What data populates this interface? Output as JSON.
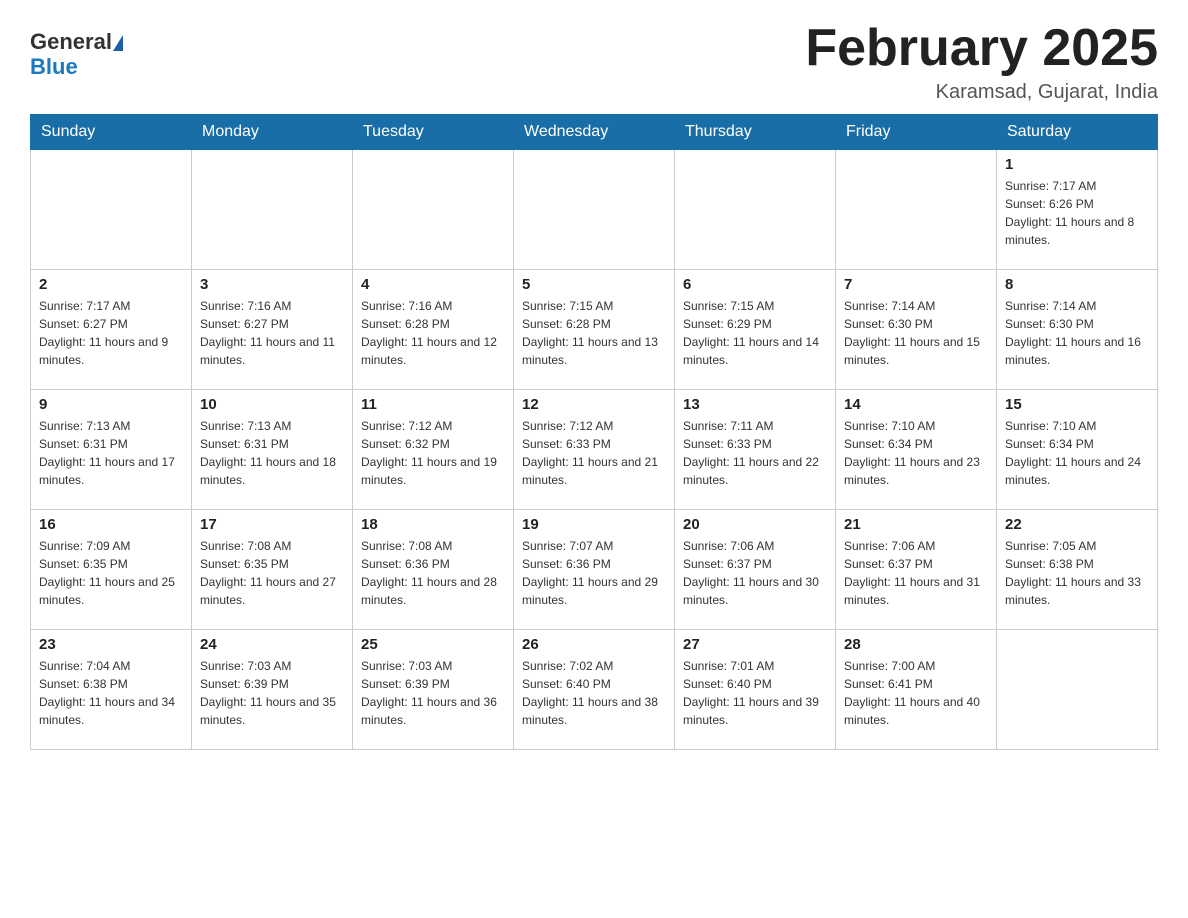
{
  "header": {
    "logo_general": "General",
    "logo_blue": "Blue",
    "month_title": "February 2025",
    "location": "Karamsad, Gujarat, India"
  },
  "days_of_week": [
    "Sunday",
    "Monday",
    "Tuesday",
    "Wednesday",
    "Thursday",
    "Friday",
    "Saturday"
  ],
  "weeks": [
    [
      {
        "day": "",
        "sunrise": "",
        "sunset": "",
        "daylight": ""
      },
      {
        "day": "",
        "sunrise": "",
        "sunset": "",
        "daylight": ""
      },
      {
        "day": "",
        "sunrise": "",
        "sunset": "",
        "daylight": ""
      },
      {
        "day": "",
        "sunrise": "",
        "sunset": "",
        "daylight": ""
      },
      {
        "day": "",
        "sunrise": "",
        "sunset": "",
        "daylight": ""
      },
      {
        "day": "",
        "sunrise": "",
        "sunset": "",
        "daylight": ""
      },
      {
        "day": "1",
        "sunrise": "Sunrise: 7:17 AM",
        "sunset": "Sunset: 6:26 PM",
        "daylight": "Daylight: 11 hours and 8 minutes."
      }
    ],
    [
      {
        "day": "2",
        "sunrise": "Sunrise: 7:17 AM",
        "sunset": "Sunset: 6:27 PM",
        "daylight": "Daylight: 11 hours and 9 minutes."
      },
      {
        "day": "3",
        "sunrise": "Sunrise: 7:16 AM",
        "sunset": "Sunset: 6:27 PM",
        "daylight": "Daylight: 11 hours and 11 minutes."
      },
      {
        "day": "4",
        "sunrise": "Sunrise: 7:16 AM",
        "sunset": "Sunset: 6:28 PM",
        "daylight": "Daylight: 11 hours and 12 minutes."
      },
      {
        "day": "5",
        "sunrise": "Sunrise: 7:15 AM",
        "sunset": "Sunset: 6:28 PM",
        "daylight": "Daylight: 11 hours and 13 minutes."
      },
      {
        "day": "6",
        "sunrise": "Sunrise: 7:15 AM",
        "sunset": "Sunset: 6:29 PM",
        "daylight": "Daylight: 11 hours and 14 minutes."
      },
      {
        "day": "7",
        "sunrise": "Sunrise: 7:14 AM",
        "sunset": "Sunset: 6:30 PM",
        "daylight": "Daylight: 11 hours and 15 minutes."
      },
      {
        "day": "8",
        "sunrise": "Sunrise: 7:14 AM",
        "sunset": "Sunset: 6:30 PM",
        "daylight": "Daylight: 11 hours and 16 minutes."
      }
    ],
    [
      {
        "day": "9",
        "sunrise": "Sunrise: 7:13 AM",
        "sunset": "Sunset: 6:31 PM",
        "daylight": "Daylight: 11 hours and 17 minutes."
      },
      {
        "day": "10",
        "sunrise": "Sunrise: 7:13 AM",
        "sunset": "Sunset: 6:31 PM",
        "daylight": "Daylight: 11 hours and 18 minutes."
      },
      {
        "day": "11",
        "sunrise": "Sunrise: 7:12 AM",
        "sunset": "Sunset: 6:32 PM",
        "daylight": "Daylight: 11 hours and 19 minutes."
      },
      {
        "day": "12",
        "sunrise": "Sunrise: 7:12 AM",
        "sunset": "Sunset: 6:33 PM",
        "daylight": "Daylight: 11 hours and 21 minutes."
      },
      {
        "day": "13",
        "sunrise": "Sunrise: 7:11 AM",
        "sunset": "Sunset: 6:33 PM",
        "daylight": "Daylight: 11 hours and 22 minutes."
      },
      {
        "day": "14",
        "sunrise": "Sunrise: 7:10 AM",
        "sunset": "Sunset: 6:34 PM",
        "daylight": "Daylight: 11 hours and 23 minutes."
      },
      {
        "day": "15",
        "sunrise": "Sunrise: 7:10 AM",
        "sunset": "Sunset: 6:34 PM",
        "daylight": "Daylight: 11 hours and 24 minutes."
      }
    ],
    [
      {
        "day": "16",
        "sunrise": "Sunrise: 7:09 AM",
        "sunset": "Sunset: 6:35 PM",
        "daylight": "Daylight: 11 hours and 25 minutes."
      },
      {
        "day": "17",
        "sunrise": "Sunrise: 7:08 AM",
        "sunset": "Sunset: 6:35 PM",
        "daylight": "Daylight: 11 hours and 27 minutes."
      },
      {
        "day": "18",
        "sunrise": "Sunrise: 7:08 AM",
        "sunset": "Sunset: 6:36 PM",
        "daylight": "Daylight: 11 hours and 28 minutes."
      },
      {
        "day": "19",
        "sunrise": "Sunrise: 7:07 AM",
        "sunset": "Sunset: 6:36 PM",
        "daylight": "Daylight: 11 hours and 29 minutes."
      },
      {
        "day": "20",
        "sunrise": "Sunrise: 7:06 AM",
        "sunset": "Sunset: 6:37 PM",
        "daylight": "Daylight: 11 hours and 30 minutes."
      },
      {
        "day": "21",
        "sunrise": "Sunrise: 7:06 AM",
        "sunset": "Sunset: 6:37 PM",
        "daylight": "Daylight: 11 hours and 31 minutes."
      },
      {
        "day": "22",
        "sunrise": "Sunrise: 7:05 AM",
        "sunset": "Sunset: 6:38 PM",
        "daylight": "Daylight: 11 hours and 33 minutes."
      }
    ],
    [
      {
        "day": "23",
        "sunrise": "Sunrise: 7:04 AM",
        "sunset": "Sunset: 6:38 PM",
        "daylight": "Daylight: 11 hours and 34 minutes."
      },
      {
        "day": "24",
        "sunrise": "Sunrise: 7:03 AM",
        "sunset": "Sunset: 6:39 PM",
        "daylight": "Daylight: 11 hours and 35 minutes."
      },
      {
        "day": "25",
        "sunrise": "Sunrise: 7:03 AM",
        "sunset": "Sunset: 6:39 PM",
        "daylight": "Daylight: 11 hours and 36 minutes."
      },
      {
        "day": "26",
        "sunrise": "Sunrise: 7:02 AM",
        "sunset": "Sunset: 6:40 PM",
        "daylight": "Daylight: 11 hours and 38 minutes."
      },
      {
        "day": "27",
        "sunrise": "Sunrise: 7:01 AM",
        "sunset": "Sunset: 6:40 PM",
        "daylight": "Daylight: 11 hours and 39 minutes."
      },
      {
        "day": "28",
        "sunrise": "Sunrise: 7:00 AM",
        "sunset": "Sunset: 6:41 PM",
        "daylight": "Daylight: 11 hours and 40 minutes."
      },
      {
        "day": "",
        "sunrise": "",
        "sunset": "",
        "daylight": ""
      }
    ]
  ]
}
